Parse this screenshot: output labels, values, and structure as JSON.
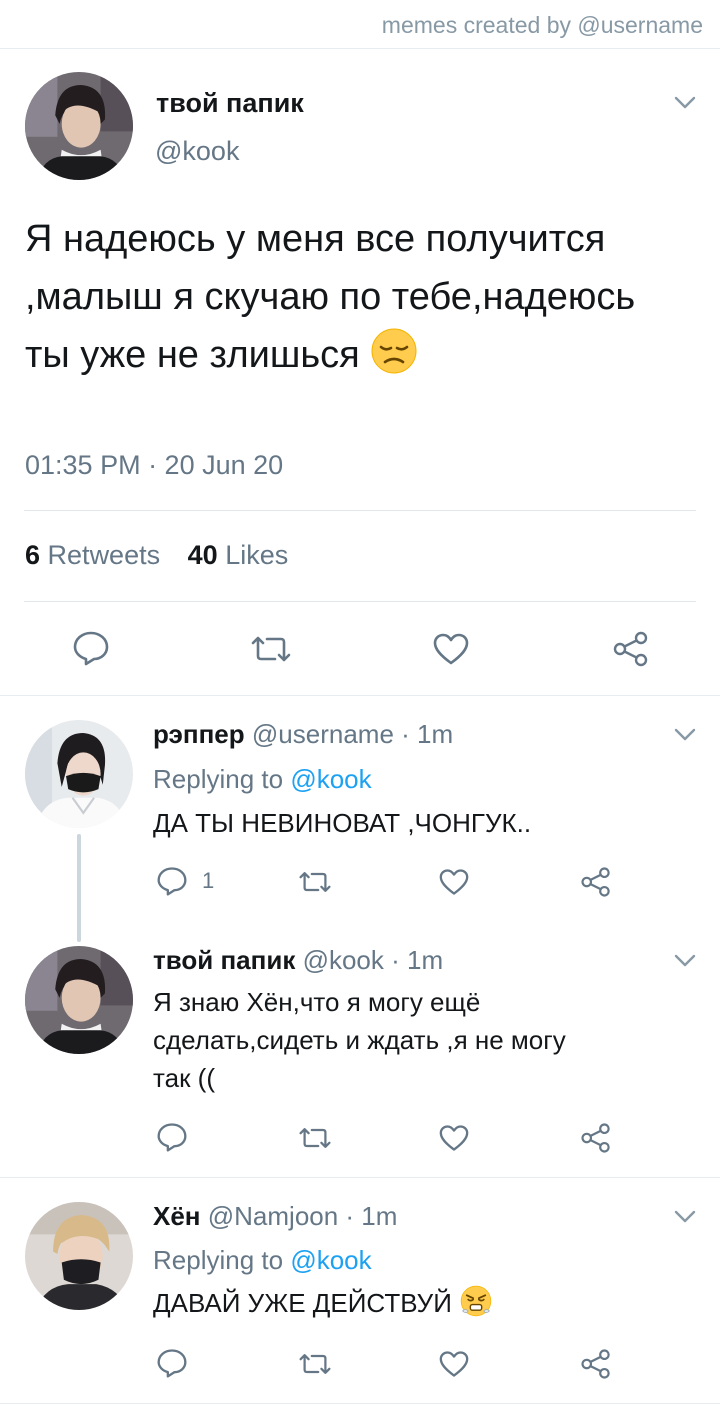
{
  "watermark": "memes created by @username",
  "main_tweet": {
    "name": "твой папик",
    "handle": "@kook",
    "text": "Я надеюсь у меня все получится ,малыш я скучаю по тебе,надеюсь ты уже не злишься",
    "emoji": "disappointed-face",
    "timestamp": "01:35 PM · 20 Jun 20",
    "retweets_count": "6",
    "retweets_label": "Retweets",
    "likes_count": "40",
    "likes_label": "Likes"
  },
  "replies": [
    {
      "name": "рэппер",
      "meta": "@username · 1m",
      "replying_prefix": "Replying to ",
      "replying_handle": "@kook",
      "text": "ДА ТЫ НЕВИНОВАТ ,ЧОНГУК..",
      "reply_count": "1"
    },
    {
      "name": "твой папик",
      "meta": "@kook · 1m",
      "text": "Я знаю Хён,что я могу ещё сделать,сидеть и ждать ,я не могу так (("
    },
    {
      "name": "Хён",
      "meta": "@Namjoon · 1m",
      "replying_prefix": "Replying to ",
      "replying_handle": "@kook",
      "text": "ДАВАЙ УЖЕ ДЕЙСТВУЙ",
      "emoji": "face-with-steam"
    }
  ],
  "colors": {
    "text": "#14171a",
    "muted": "#657786",
    "link": "#1da1f2",
    "icon": "#657786",
    "divider": "#e6ecf0"
  }
}
